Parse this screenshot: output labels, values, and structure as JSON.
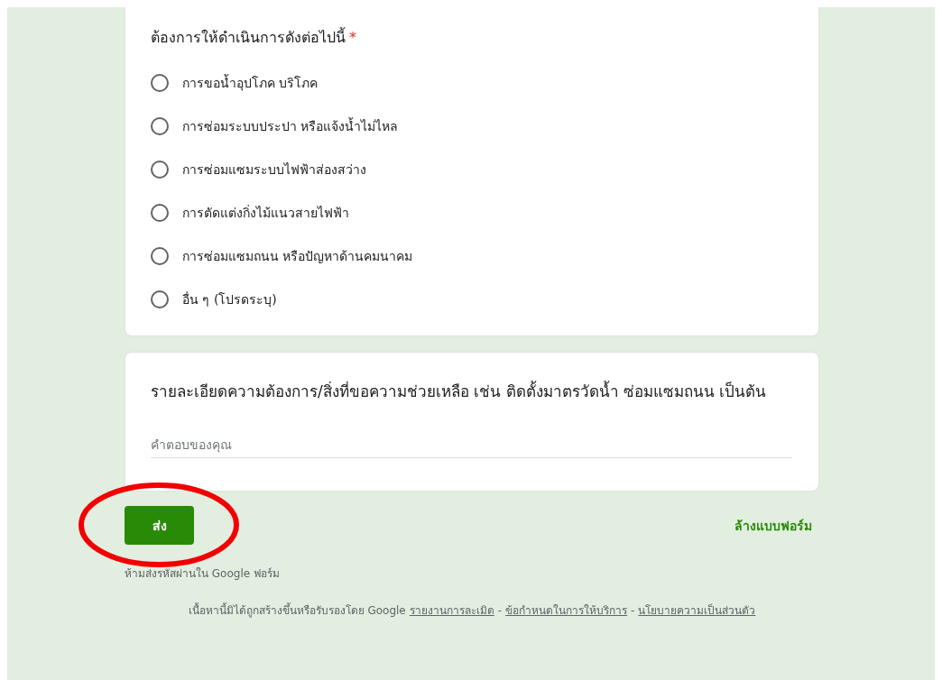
{
  "question": {
    "title": "ต้องการให้ดำเนินการดังต่อไปนี้",
    "required_mark": "*",
    "options": [
      {
        "label": "การขอน้ำอุปโภค บริโภค",
        "selected": false
      },
      {
        "label": "การซ่อมระบบประปา หรือแจ้งน้ำไม่ไหล",
        "selected": false
      },
      {
        "label": "การซ่อมแซมระบบไฟฟ้าส่องสว่าง",
        "selected": false
      },
      {
        "label": "การตัดแต่งกิ่งไม้แนวสายไฟฟ้า",
        "selected": false
      },
      {
        "label": "การซ่อมแซมถนน หรือปัญหาด้านคมนาคม",
        "selected": false
      },
      {
        "label": "อื่น ๆ (โปรดระบุ)",
        "selected": false
      }
    ]
  },
  "detail_question": {
    "title": "รายละเอียดความต้องการ/สิ่งที่ขอความช่วยเหลือ เช่น ติดตั้งมาตรวัดน้ำ ซ่อมแซมถนน เป็นต้น",
    "placeholder": "คำตอบของคุณ"
  },
  "submit_button": "ส่ง",
  "clear_link": "ล้างแบบฟอร์ม",
  "password_warning": "ห้ามส่งรหัสผ่านใน Google ฟอร์ม",
  "footer": {
    "text": "เนื้อหานี้มิได้ถูกสร้างขึ้นหรือรับรองโดย Google",
    "links": [
      "รายงานการละเมิด",
      "ข้อกำหนดในการให้บริการ",
      "นโยบายความเป็นส่วนตัว"
    ],
    "separator": "-"
  },
  "highlight": {
    "kind": "ellipse",
    "color": "#f00000"
  }
}
